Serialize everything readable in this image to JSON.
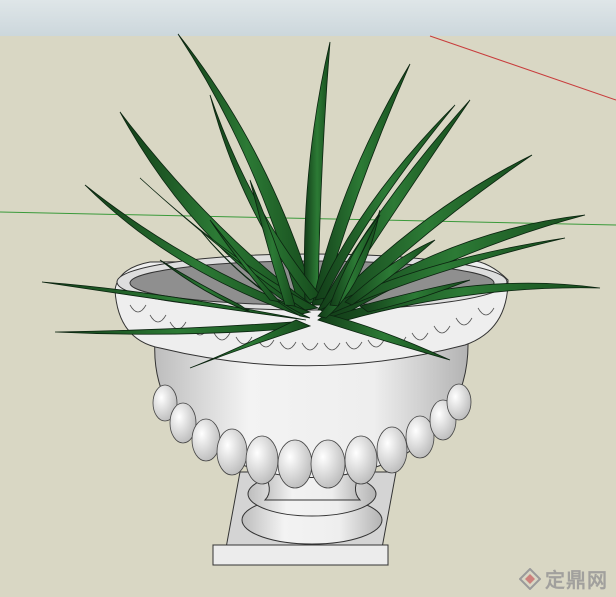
{
  "viewport": {
    "sky_color": "#d5dee2",
    "ground_color": "#d9d7c4",
    "axis_red": "#c83c3c",
    "axis_green": "#3a9a3a"
  },
  "model": {
    "object": "planter-with-grass",
    "pot_color": "#e8e8e8",
    "leaf_color": "#1f5a28"
  },
  "watermark": {
    "text": "定鼎网",
    "logo_icon": "diamond-logo-icon",
    "color": "#9a9a9a"
  }
}
